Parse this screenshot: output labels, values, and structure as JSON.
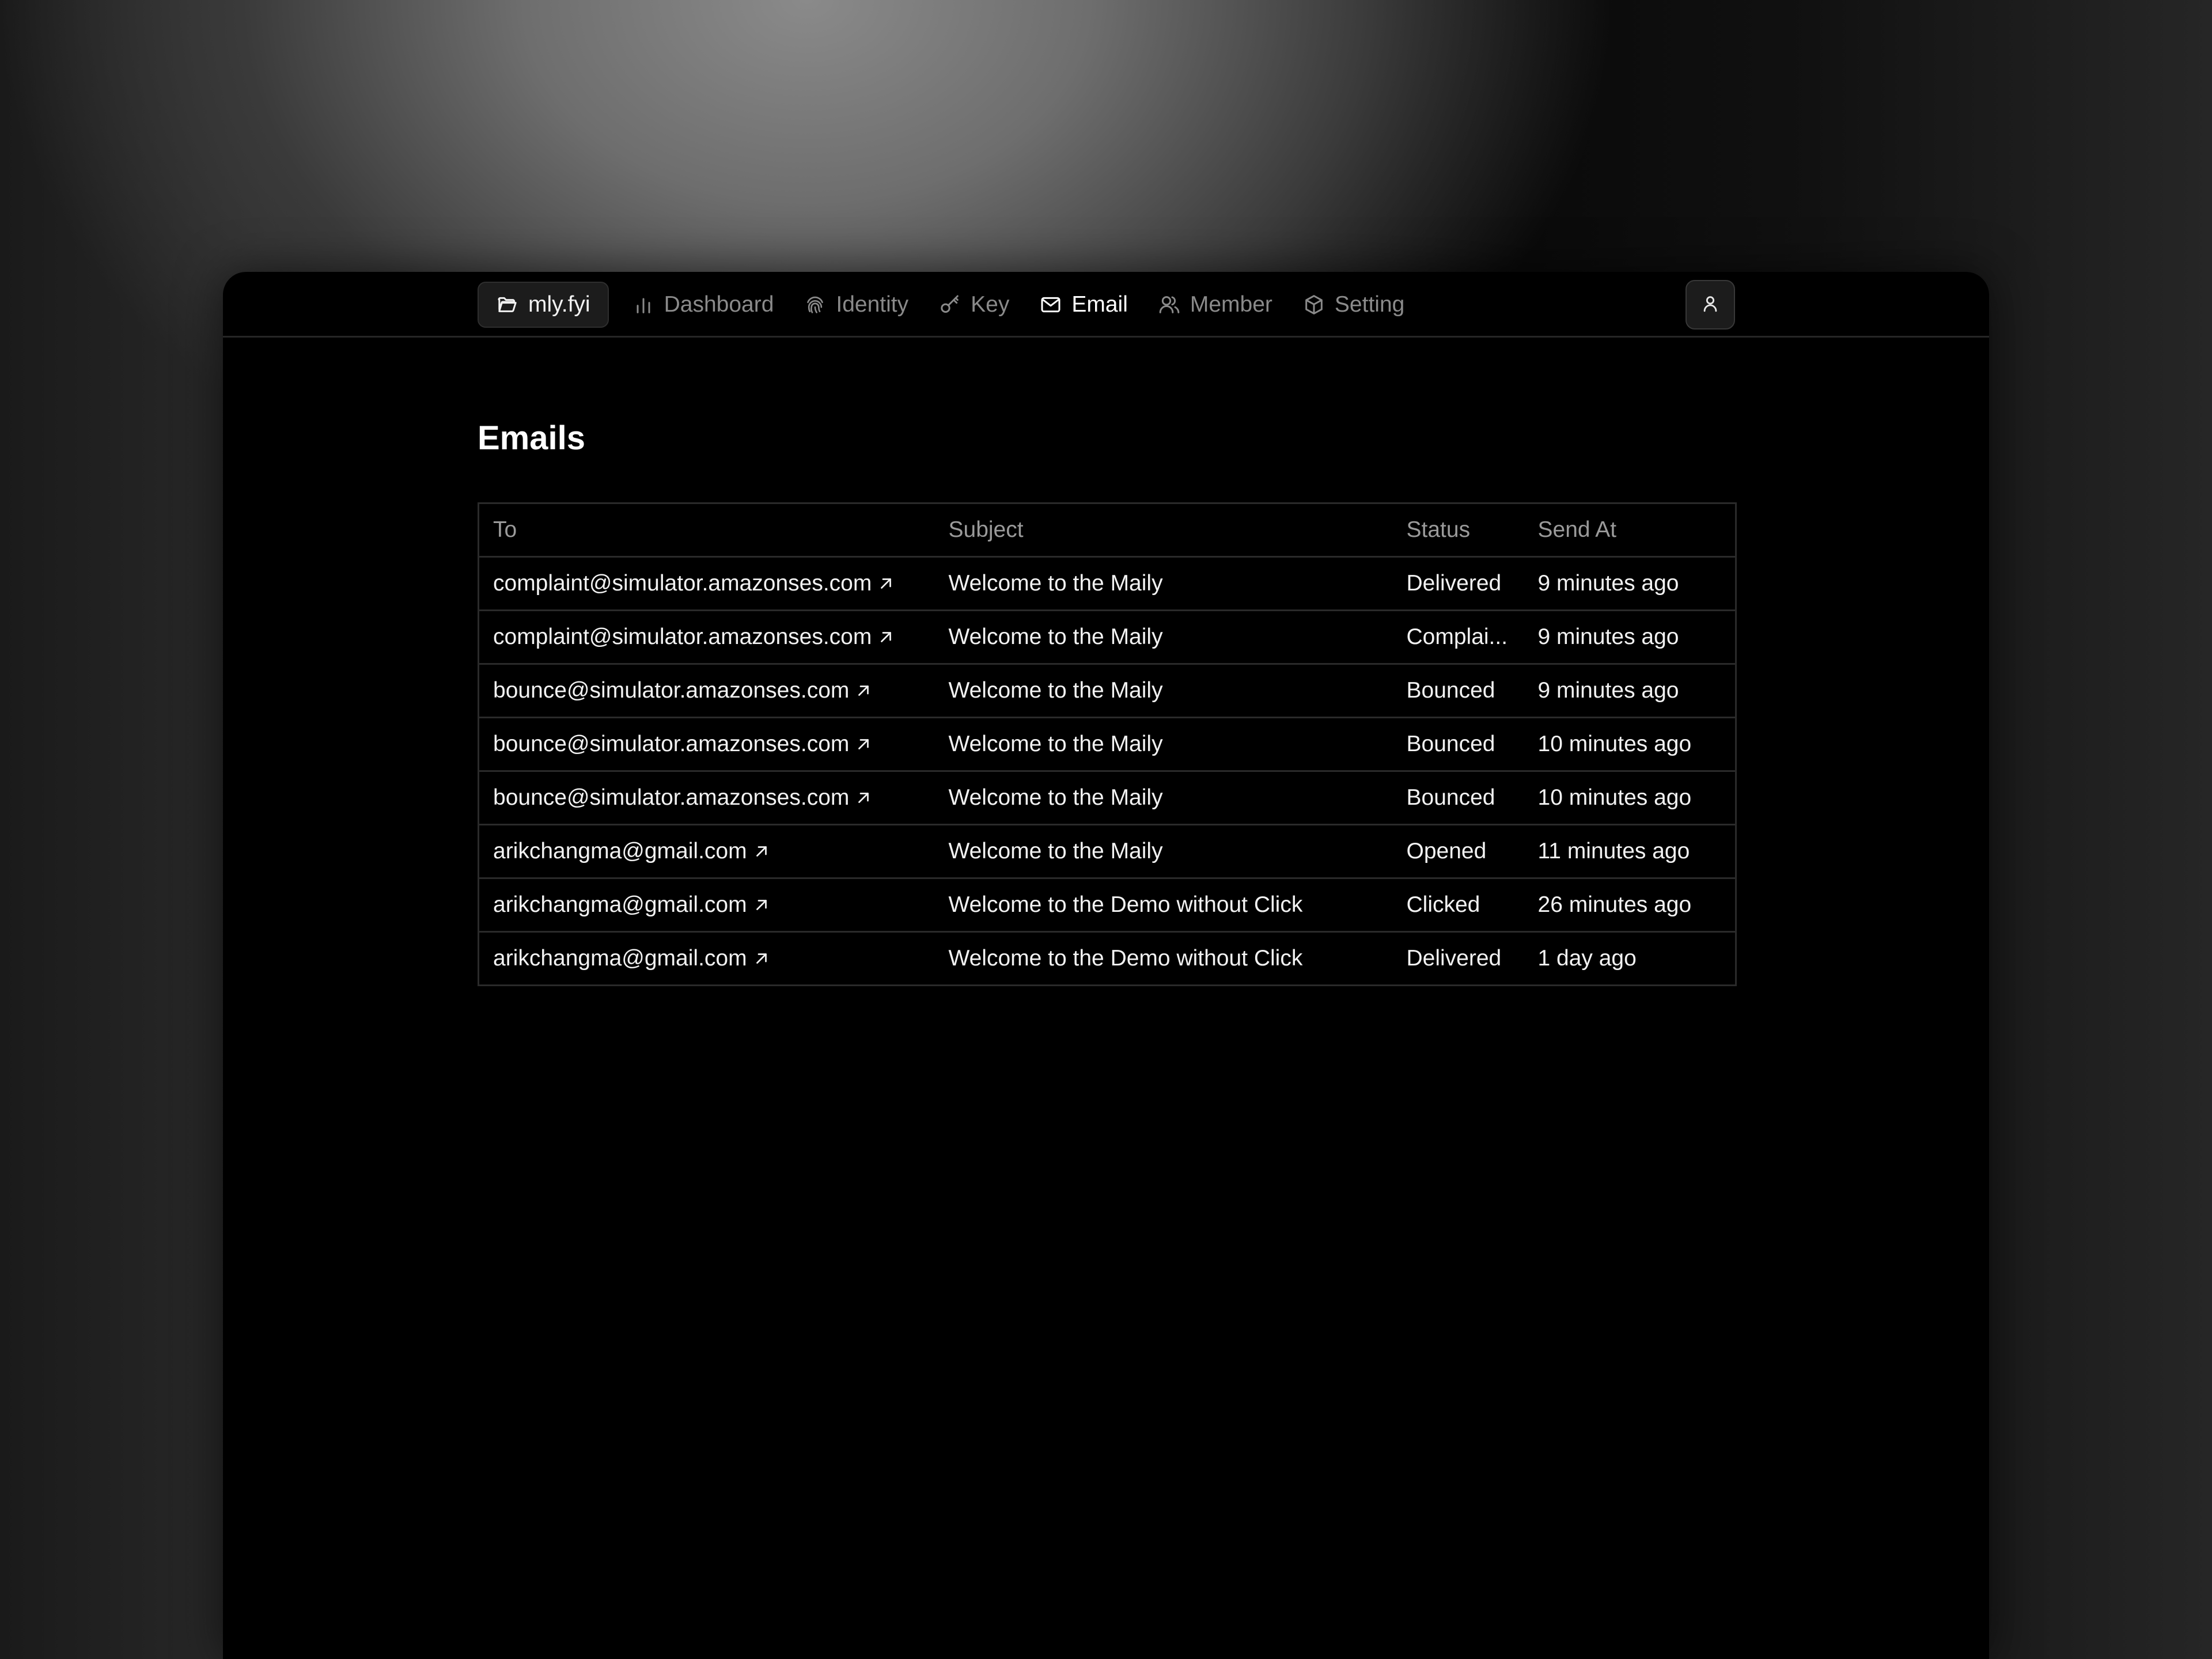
{
  "nav": {
    "brand": "mly.fyi",
    "items": [
      {
        "label": "Dashboard",
        "icon": "bar-chart-icon"
      },
      {
        "label": "Identity",
        "icon": "fingerprint-icon"
      },
      {
        "label": "Key",
        "icon": "key-icon"
      },
      {
        "label": "Email",
        "icon": "mail-icon",
        "active": true
      },
      {
        "label": "Member",
        "icon": "users-icon"
      },
      {
        "label": "Setting",
        "icon": "box-icon"
      }
    ]
  },
  "user_menu": {
    "icon": "user-icon"
  },
  "page": {
    "title": "Emails"
  },
  "table": {
    "columns": [
      "To",
      "Subject",
      "Status",
      "Send At"
    ],
    "rows": [
      {
        "to": "complaint@simulator.amazonses.com",
        "subject": "Welcome to the Maily",
        "status": "Delivered",
        "send_at": "9 minutes ago"
      },
      {
        "to": "complaint@simulator.amazonses.com",
        "subject": "Welcome to the Maily",
        "status": "Complai...",
        "send_at": "9 minutes ago"
      },
      {
        "to": "bounce@simulator.amazonses.com",
        "subject": "Welcome to the Maily",
        "status": "Bounced",
        "send_at": "9 minutes ago"
      },
      {
        "to": "bounce@simulator.amazonses.com",
        "subject": "Welcome to the Maily",
        "status": "Bounced",
        "send_at": "10 minutes ago"
      },
      {
        "to": "bounce@simulator.amazonses.com",
        "subject": "Welcome to the Maily",
        "status": "Bounced",
        "send_at": "10 minutes ago"
      },
      {
        "to": "arikchangma@gmail.com",
        "subject": "Welcome to the Maily",
        "status": "Opened",
        "send_at": "11 minutes ago"
      },
      {
        "to": "arikchangma@gmail.com",
        "subject": "Welcome to the Demo without Click",
        "status": "Clicked",
        "send_at": "26 minutes ago"
      },
      {
        "to": "arikchangma@gmail.com",
        "subject": "Welcome to the Demo without Click",
        "status": "Delivered",
        "send_at": "1 day ago"
      }
    ]
  }
}
